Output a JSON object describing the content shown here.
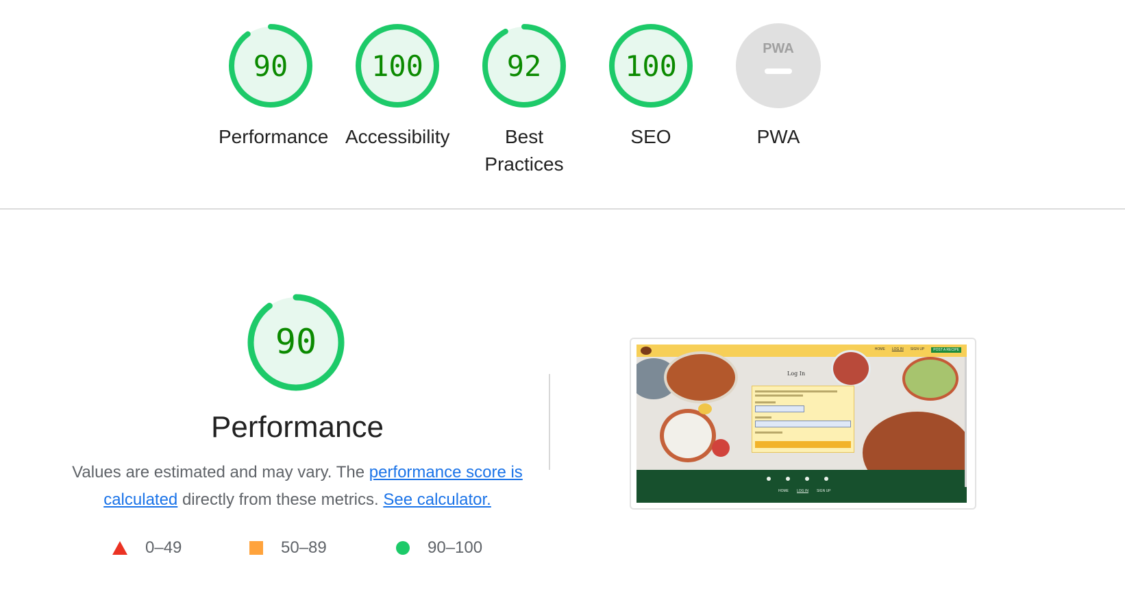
{
  "summary_gauges": [
    {
      "score": "90",
      "label": "Performance",
      "fraction": 0.9
    },
    {
      "score": "100",
      "label": "Accessibility",
      "fraction": 1.0
    },
    {
      "score": "92",
      "label": "Best Practices",
      "fraction": 0.92
    },
    {
      "score": "100",
      "label": "SEO",
      "fraction": 1.0
    },
    {
      "score": "PWA",
      "label": "PWA",
      "fraction": 0
    }
  ],
  "performance": {
    "score": "90",
    "fraction": 0.9,
    "title": "Performance",
    "desc_prefix": "Values are estimated and may vary. The ",
    "desc_link1": "performance score is calculated",
    "desc_middle": " directly from these metrics. ",
    "desc_link2": "See calculator."
  },
  "legend": [
    {
      "range": "0–49",
      "color": "#eb3223",
      "icon": "red-triangle-icon"
    },
    {
      "range": "50–89",
      "color": "#ffa33c",
      "icon": "orange-square-icon"
    },
    {
      "range": "90–100",
      "color": "#1dca69",
      "icon": "green-circle-icon"
    }
  ],
  "screenshot": {
    "nav_links": [
      "HOME",
      "LOG IN",
      "SIGN UP"
    ],
    "nav_cta": "POST A RECIPE",
    "title": "Log In",
    "footer_links": [
      "HOME",
      "LOG IN",
      "SIGN UP"
    ]
  },
  "colors": {
    "pass_green": "#1dca69",
    "pass_fill": "#e7f8ee",
    "score_text": "#0b8a00",
    "pwa_gray": "#e0e0e0"
  }
}
